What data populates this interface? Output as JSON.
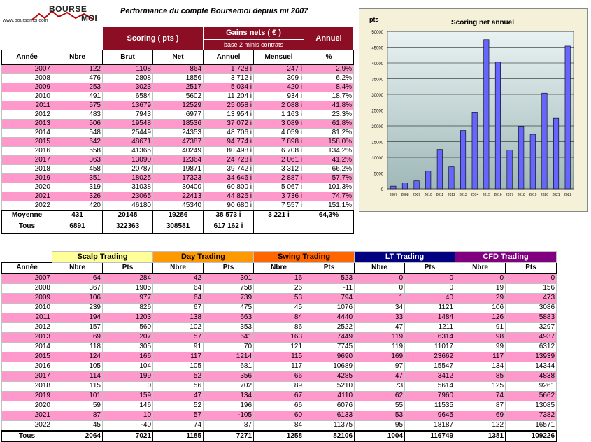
{
  "logo": {
    "line1": "BOURSE",
    "line2": "MOI",
    "url": "www.boursemoi.com"
  },
  "title": "Performance du compte Boursemoi  depuis mi 2007",
  "table1": {
    "group_scoring": "Scoring ( pts )",
    "group_gains": "Gains nets ( € )",
    "group_gains_sub": "base 2 minis contrats",
    "group_annuel": "Annuel",
    "columns": [
      "Année",
      "Nbre",
      "Brut",
      "Net",
      "Annuel",
      "Mensuel",
      "%"
    ],
    "rows": [
      [
        "2007",
        "122",
        "1108",
        "864",
        "1 728 i",
        "247 i",
        "2,9%"
      ],
      [
        "2008",
        "476",
        "2808",
        "1856",
        "3 712 i",
        "309 i",
        "6,2%"
      ],
      [
        "2009",
        "253",
        "3023",
        "2517",
        "5 034 i",
        "420 i",
        "8,4%"
      ],
      [
        "2010",
        "491",
        "6584",
        "5602",
        "11 204 i",
        "934 i",
        "18,7%"
      ],
      [
        "2011",
        "575",
        "13679",
        "12529",
        "25 058 i",
        "2 088 i",
        "41,8%"
      ],
      [
        "2012",
        "483",
        "7943",
        "6977",
        "13 954 i",
        "1 163 i",
        "23,3%"
      ],
      [
        "2013",
        "506",
        "19548",
        "18536",
        "37 072 i",
        "3 089 i",
        "61,8%"
      ],
      [
        "2014",
        "548",
        "25449",
        "24353",
        "48 706 i",
        "4 059 i",
        "81,2%"
      ],
      [
        "2015",
        "642",
        "48671",
        "47387",
        "94 774 i",
        "7 898 i",
        "158,0%"
      ],
      [
        "2016",
        "558",
        "41365",
        "40249",
        "80 498 i",
        "6 708 i",
        "134,2%"
      ],
      [
        "2017",
        "363",
        "13090",
        "12364",
        "24 728 i",
        "2 061 i",
        "41,2%"
      ],
      [
        "2018",
        "458",
        "20787",
        "19871",
        "39 742 i",
        "3 312 i",
        "66,2%"
      ],
      [
        "2019",
        "351",
        "18025",
        "17323",
        "34 646 i",
        "2 887 i",
        "57,7%"
      ],
      [
        "2020",
        "319",
        "31038",
        "30400",
        "60 800 i",
        "5 067 i",
        "101,3%"
      ],
      [
        "2021",
        "326",
        "23065",
        "22413",
        "44 826 i",
        "3 736 i",
        "74,7%"
      ],
      [
        "2022",
        "420",
        "46180",
        "45340",
        "90 680 i",
        "7 557 i",
        "151,1%"
      ]
    ],
    "moyenne": [
      "Moyenne",
      "431",
      "20148",
      "19286",
      "38 573 i",
      "3 221 i",
      "64,3%"
    ],
    "tous": [
      "Tous",
      "6891",
      "322363",
      "308581",
      "617 162 i",
      "",
      ""
    ]
  },
  "colors": {
    "pink_row": "#ff99cc",
    "header_dark_red": "#8b0e24",
    "scalp": "#ffff99",
    "day": "#ff9900",
    "swing": "#ff6600",
    "lt": "#000080",
    "cfd": "#800080",
    "bar": "#6666ff",
    "chart_bg": "#f5f0d8"
  },
  "chart_data": {
    "type": "bar",
    "title": "Scoring net annuel",
    "ylabel": "pts",
    "categories": [
      "2007",
      "2008",
      "2009",
      "2010",
      "2011",
      "2012",
      "2013",
      "2014",
      "2015",
      "2016",
      "2017",
      "2018",
      "2019",
      "2020",
      "2021",
      "2022"
    ],
    "values": [
      864,
      1856,
      2517,
      5602,
      12529,
      6977,
      18536,
      24353,
      47387,
      40249,
      12364,
      19871,
      17323,
      30400,
      22413,
      45340
    ],
    "ylim": [
      0,
      50000
    ],
    "yticks": [
      0,
      5000,
      10000,
      15000,
      20000,
      25000,
      30000,
      35000,
      40000,
      45000,
      50000
    ],
    "grid": true
  },
  "table2": {
    "groups": [
      "Scalp Trading",
      "Day Trading",
      "Swing Trading",
      "LT Trading",
      "CFD Trading"
    ],
    "col_annee": "Année",
    "col_nbre": "Nbre",
    "col_pts": "Pts",
    "rows": [
      [
        "2007",
        "64",
        "284",
        "42",
        "301",
        "16",
        "523",
        "0",
        "0",
        "0",
        "0"
      ],
      [
        "2008",
        "367",
        "1905",
        "64",
        "758",
        "26",
        "-11",
        "0",
        "0",
        "19",
        "156"
      ],
      [
        "2009",
        "106",
        "977",
        "64",
        "739",
        "53",
        "794",
        "1",
        "40",
        "29",
        "473"
      ],
      [
        "2010",
        "239",
        "826",
        "67",
        "475",
        "45",
        "1076",
        "34",
        "1121",
        "106",
        "3086"
      ],
      [
        "2011",
        "194",
        "1203",
        "138",
        "663",
        "84",
        "4440",
        "33",
        "1484",
        "126",
        "5883"
      ],
      [
        "2012",
        "157",
        "560",
        "102",
        "353",
        "86",
        "2522",
        "47",
        "1211",
        "91",
        "3297"
      ],
      [
        "2013",
        "69",
        "207",
        "57",
        "641",
        "163",
        "7449",
        "119",
        "6314",
        "98",
        "4937"
      ],
      [
        "2014",
        "118",
        "305",
        "91",
        "70",
        "121",
        "7745",
        "119",
        "11017",
        "99",
        "6312"
      ],
      [
        "2015",
        "124",
        "166",
        "117",
        "1214",
        "115",
        "9690",
        "169",
        "23662",
        "117",
        "13939"
      ],
      [
        "2016",
        "105",
        "104",
        "105",
        "681",
        "117",
        "10689",
        "97",
        "15547",
        "134",
        "14344"
      ],
      [
        "2017",
        "114",
        "199",
        "52",
        "356",
        "66",
        "4285",
        "47",
        "3412",
        "85",
        "4838"
      ],
      [
        "2018",
        "115",
        "0",
        "56",
        "702",
        "89",
        "5210",
        "73",
        "5614",
        "125",
        "9261"
      ],
      [
        "2019",
        "101",
        "159",
        "47",
        "134",
        "67",
        "4110",
        "62",
        "7960",
        "74",
        "5662"
      ],
      [
        "2020",
        "59",
        "146",
        "52",
        "196",
        "66",
        "6076",
        "55",
        "11535",
        "87",
        "13085"
      ],
      [
        "2021",
        "87",
        "10",
        "57",
        "-105",
        "60",
        "6133",
        "53",
        "9645",
        "69",
        "7382"
      ],
      [
        "2022",
        "45",
        "-40",
        "74",
        "87",
        "84",
        "11375",
        "95",
        "18187",
        "122",
        "16571"
      ]
    ],
    "tous": [
      "Tous",
      "2064",
      "7021",
      "1185",
      "7271",
      "1258",
      "82106",
      "1004",
      "116749",
      "1381",
      "109226"
    ]
  }
}
